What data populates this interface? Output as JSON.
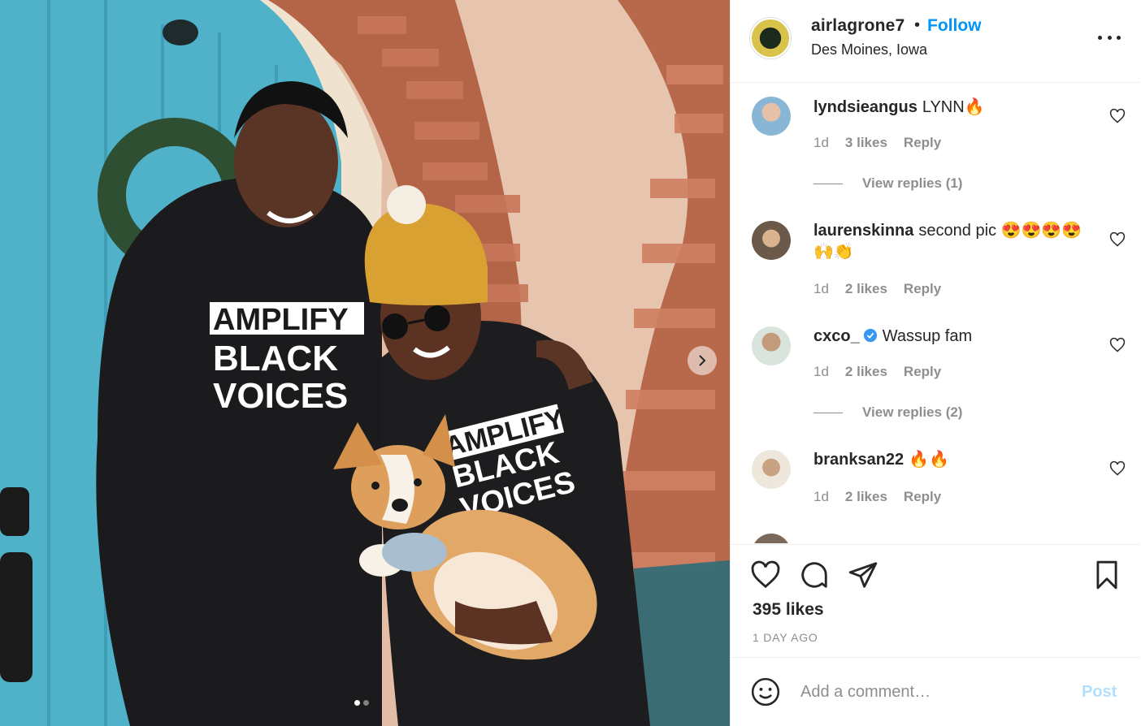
{
  "post": {
    "username": "airlagrone7",
    "separator": "•",
    "follow_label": "Follow",
    "location": "Des Moines, Iowa",
    "photo_text": {
      "hoodie_left": [
        "AMPLIFY",
        "BLACK",
        "VOICES"
      ],
      "hoodie_right": [
        "AMPLIFY",
        "BLACK",
        "VOICES"
      ]
    },
    "carousel": {
      "current": 1,
      "total": 2
    }
  },
  "comments": [
    {
      "user": "lyndsieangus",
      "text": "LYNN🔥",
      "time": "1d",
      "likes": "3 likes",
      "reply": "Reply",
      "view_replies": "View replies (1)",
      "verified": false
    },
    {
      "user": "laurenskinna",
      "text": "second pic 😍😍😍😍🙌👏",
      "time": "1d",
      "likes": "2 likes",
      "reply": "Reply",
      "verified": false
    },
    {
      "user": "cxco_",
      "text": "Wassup fam",
      "time": "1d",
      "likes": "2 likes",
      "reply": "Reply",
      "view_replies": "View replies (2)",
      "verified": true
    },
    {
      "user": "branksan22",
      "text": "🔥🔥",
      "time": "1d",
      "likes": "2 likes",
      "reply": "Reply",
      "verified": false
    }
  ],
  "footer": {
    "likes": "395 likes",
    "time_ago": "1 DAY AGO",
    "comment_placeholder": "Add a comment…",
    "post_label": "Post"
  },
  "icons": {
    "header_more": "more-icon",
    "like": "heart-icon",
    "comment": "comment-icon",
    "share": "share-icon",
    "save": "bookmark-icon",
    "emoji": "emoji-icon",
    "carousel_next": "chevron-right-icon",
    "verified": "verified-badge-icon"
  },
  "colors": {
    "link": "#0095f6",
    "post_disabled": "#b2dffc",
    "meta_gray": "#8e8e8e",
    "verified_blue": "#3897f0"
  }
}
